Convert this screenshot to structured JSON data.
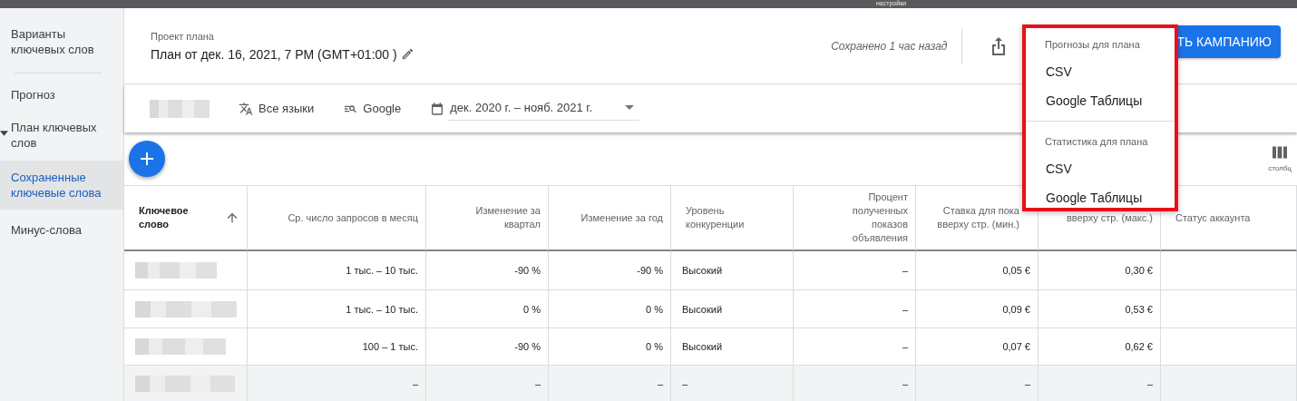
{
  "top_strip": {
    "label": "настройки"
  },
  "sidebar": {
    "items": [
      {
        "label": "Варианты ключевых слов",
        "selected": false,
        "divider_after": true
      },
      {
        "label": "Прогноз",
        "selected": false
      },
      {
        "label": "План ключевых слов",
        "selected": false,
        "expanded": true
      },
      {
        "label": "Сохраненные ключевые слова",
        "selected": true
      },
      {
        "label": "Минус-слова",
        "selected": false
      }
    ]
  },
  "header": {
    "caption": "Проект плана",
    "title": "План от дек. 16, 2021, 7 PM (GMT+01:00 )",
    "saved": "Сохранено 1 час назад",
    "button": "ТЬ КАМПАНИЮ"
  },
  "filters": {
    "language": "Все языки",
    "network": "Google",
    "date_range": "дек. 2020 г. – нояб. 2021 г."
  },
  "columns_button": {
    "label": "столбц"
  },
  "table": {
    "columns": [
      {
        "lines": [
          "Ключевое",
          "слово"
        ],
        "bold": true,
        "sorted": true
      },
      {
        "lines": [
          "Ср. число запросов в месяц"
        ]
      },
      {
        "lines": [
          "Изменение за",
          "квартал"
        ]
      },
      {
        "lines": [
          "Изменение за год"
        ]
      },
      {
        "lines": [
          "Уровень",
          "конкуренции"
        ]
      },
      {
        "lines": [
          "Процент",
          "полученных",
          "показов",
          "объявления"
        ]
      },
      {
        "lines": [
          "Ставка для пока",
          "вверху стр. (мин.)"
        ]
      },
      {
        "lines": [
          "вверху стр. (макс.)"
        ]
      },
      {
        "lines": [
          "Статус аккаунта"
        ]
      }
    ],
    "rows": [
      {
        "kind": "data",
        "values": [
          "1 тыс. – 10 тыс.",
          "-90 %",
          "-90 %",
          "Высокий",
          "–",
          "0,05 €",
          "0,30 €"
        ]
      },
      {
        "kind": "data",
        "values": [
          "1 тыс. – 10 тыс.",
          "0 %",
          "0 %",
          "Высокий",
          "–",
          "0,09 €",
          "0,53 €"
        ]
      },
      {
        "kind": "data",
        "values": [
          "100 – 1 тыс.",
          "-90 %",
          "0 %",
          "Высокий",
          "–",
          "0,07 €",
          "0,62 €"
        ]
      },
      {
        "kind": "summary",
        "values": [
          "–",
          "–",
          "–",
          "–",
          "–",
          "–",
          "–"
        ]
      }
    ]
  },
  "export_menu": {
    "sections": [
      {
        "title": "Прогнозы для плана",
        "items": [
          "CSV",
          "Google Таблицы"
        ]
      },
      {
        "title": "Статистика для плана",
        "items": [
          "CSV",
          "Google Таблицы"
        ]
      }
    ]
  }
}
